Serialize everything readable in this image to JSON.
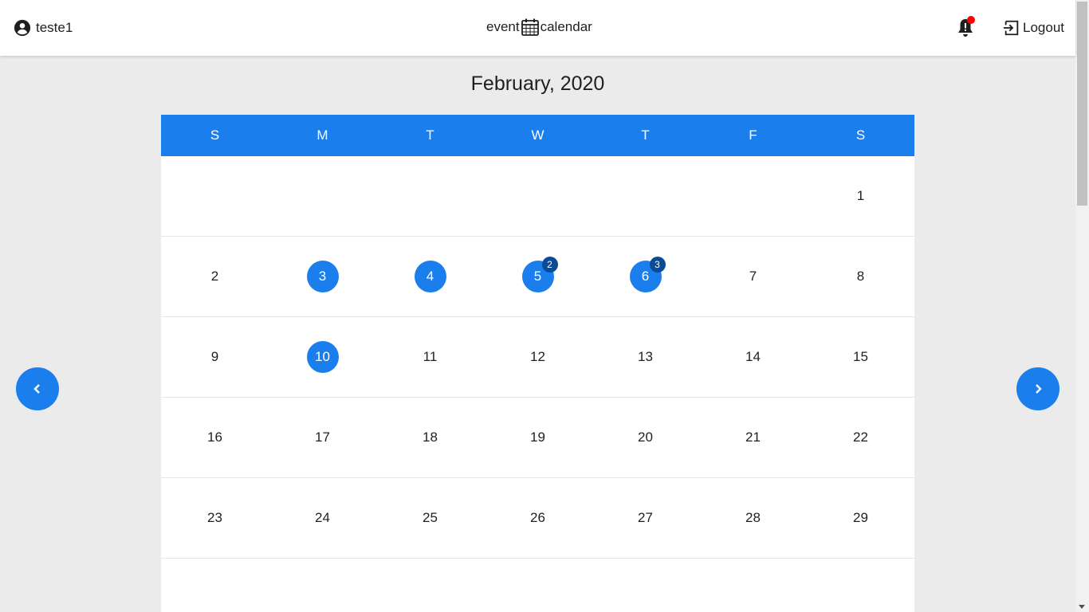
{
  "header": {
    "username": "teste1",
    "brand_left": "event",
    "brand_right": "calendar",
    "logout_label": "Logout",
    "icons": {
      "user": "account-circle-icon",
      "brand": "calendar-icon",
      "notification": "bell-alert-icon",
      "logout": "logout-icon"
    }
  },
  "calendar": {
    "month_title": "February, 2020",
    "weekdays": [
      "S",
      "M",
      "T",
      "W",
      "T",
      "F",
      "S"
    ],
    "weeks": [
      [
        {
          "day": ""
        },
        {
          "day": ""
        },
        {
          "day": ""
        },
        {
          "day": ""
        },
        {
          "day": ""
        },
        {
          "day": ""
        },
        {
          "day": "1"
        }
      ],
      [
        {
          "day": "2"
        },
        {
          "day": "3",
          "event": true
        },
        {
          "day": "4",
          "event": true
        },
        {
          "day": "5",
          "event": true,
          "badge": "2"
        },
        {
          "day": "6",
          "event": true,
          "badge": "3"
        },
        {
          "day": "7"
        },
        {
          "day": "8"
        }
      ],
      [
        {
          "day": "9"
        },
        {
          "day": "10",
          "event": true
        },
        {
          "day": "11"
        },
        {
          "day": "12"
        },
        {
          "day": "13"
        },
        {
          "day": "14"
        },
        {
          "day": "15"
        }
      ],
      [
        {
          "day": "16"
        },
        {
          "day": "17"
        },
        {
          "day": "18"
        },
        {
          "day": "19"
        },
        {
          "day": "20"
        },
        {
          "day": "21"
        },
        {
          "day": "22"
        }
      ],
      [
        {
          "day": "23"
        },
        {
          "day": "24"
        },
        {
          "day": "25"
        },
        {
          "day": "26"
        },
        {
          "day": "27"
        },
        {
          "day": "28"
        },
        {
          "day": "29"
        }
      ]
    ]
  },
  "navigation": {
    "prev_icon": "chevron-left-icon",
    "next_icon": "chevron-right-icon"
  },
  "colors": {
    "accent": "#1a7fec",
    "badge": "#0b4a94",
    "notification_dot": "#ff0000",
    "background": "#ebebeb"
  }
}
